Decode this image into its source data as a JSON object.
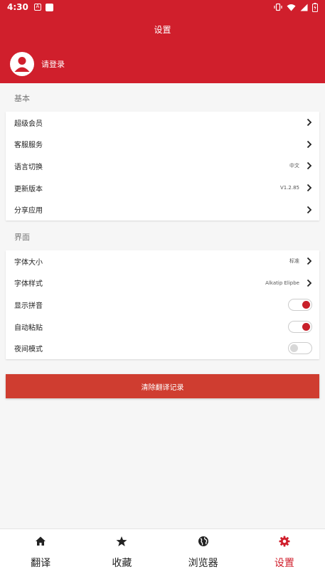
{
  "status_bar": {
    "time": "4:30",
    "notif_glyph": "A"
  },
  "header": {
    "title": "设置",
    "login_label": "请登录"
  },
  "sections": {
    "basic": {
      "title": "基本",
      "items": [
        {
          "label": "超级会员",
          "value": ""
        },
        {
          "label": "客服服务",
          "value": ""
        },
        {
          "label": "语言切换",
          "value": "中文"
        },
        {
          "label": "更新版本",
          "value": "V1.2.85"
        },
        {
          "label": "分享应用",
          "value": ""
        }
      ]
    },
    "interface": {
      "title": "界面",
      "items": [
        {
          "label": "字体大小",
          "value": "标准"
        },
        {
          "label": "字体样式",
          "value": "Alkatip Elipbe"
        },
        {
          "label": "显示拼音",
          "toggle": true
        },
        {
          "label": "自动粘贴",
          "toggle": true
        },
        {
          "label": "夜间模式",
          "toggle": false
        }
      ]
    }
  },
  "clear_button_label": "清除翻译记录",
  "bottom_nav": {
    "items": [
      {
        "label": "翻译",
        "icon": "home-icon"
      },
      {
        "label": "收藏",
        "icon": "star-icon"
      },
      {
        "label": "浏览器",
        "icon": "globe-icon"
      },
      {
        "label": "设置",
        "icon": "gear-icon",
        "active": true
      }
    ]
  },
  "colors": {
    "brand": "#d01f2c",
    "button": "#cf3d30",
    "toggle_on": "#c8202a"
  }
}
